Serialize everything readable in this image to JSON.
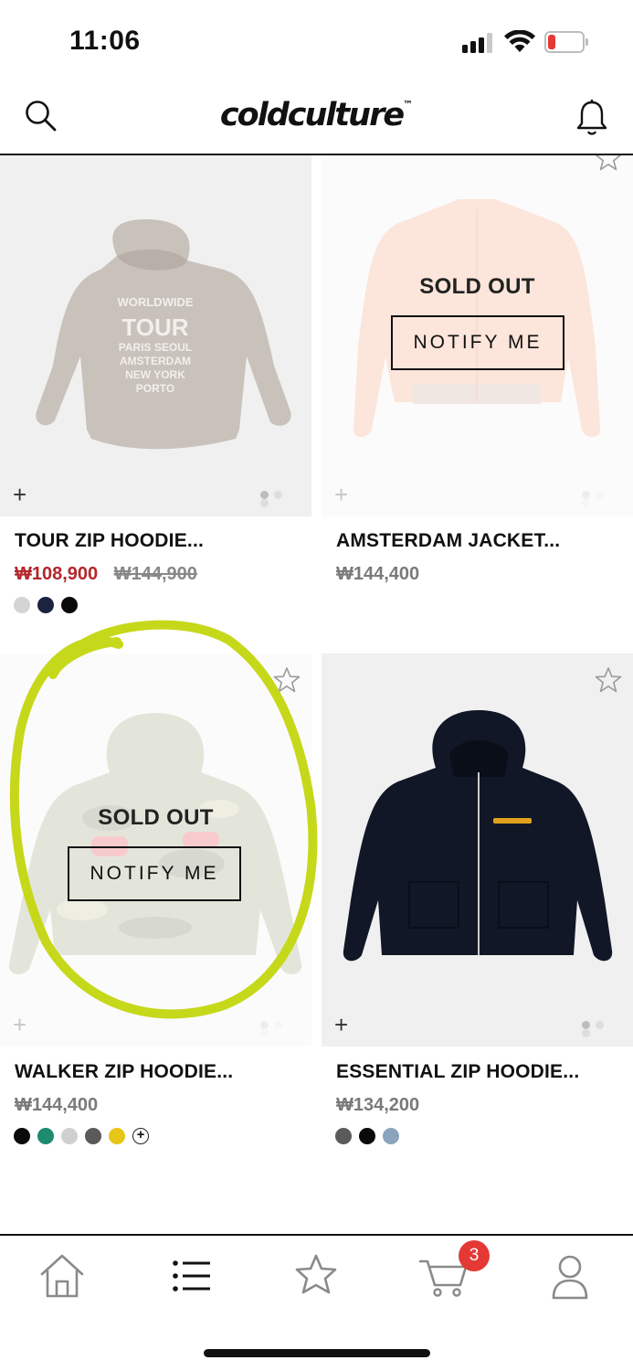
{
  "status_bar": {
    "time": "11:06",
    "battery": "12"
  },
  "header": {
    "logo": "coldculture",
    "logo_mark": "™"
  },
  "products": [
    {
      "name": "TOUR ZIP HOODIE...",
      "sale_price": "₩108,900",
      "original_price": "₩144,900",
      "sold_out": false,
      "swatches": [
        "#d4d4d4",
        "#1c2340",
        "#0a0a0a"
      ],
      "image": "beige-hoodie-back"
    },
    {
      "name": "AMSTERDAM JACKET...",
      "price": "₩144,400",
      "sold_out": true,
      "sold_out_label": "SOLD OUT",
      "notify_label": "NOTIFY ME",
      "swatches": [],
      "image": "orange-track-jacket"
    },
    {
      "name": "WALKER ZIP HOODIE...",
      "price": "₩144,400",
      "sold_out": true,
      "sold_out_label": "SOLD OUT",
      "notify_label": "NOTIFY ME",
      "swatches": [
        "#0a0a0a",
        "#1e8a70",
        "#d0d0d0",
        "#5a5a5a",
        "#e6c619"
      ],
      "more_swatches": "+",
      "image": "camo-zip-hoodie"
    },
    {
      "name": "ESSENTIAL ZIP HOODIE...",
      "price": "₩134,200",
      "sold_out": false,
      "swatches": [
        "#5a5a5a",
        "#0a0a0a",
        "#8ba3bd"
      ],
      "image": "navy-zip-hoodie"
    }
  ],
  "tabbar": {
    "items": [
      "home-icon",
      "list-icon",
      "star-icon",
      "cart-icon",
      "user-icon"
    ],
    "cart_count": "3"
  },
  "colors": {
    "sale": "#b3262b",
    "annotation": "#c6d81a",
    "badge": "#e53935"
  }
}
